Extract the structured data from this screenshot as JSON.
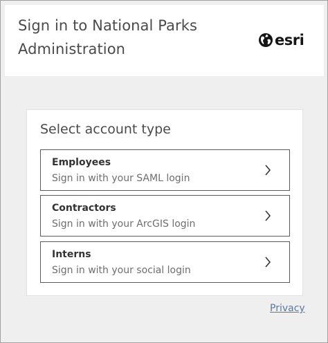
{
  "header": {
    "title": "Sign in to National Parks Administration",
    "logo": {
      "icon": "globe-icon",
      "text": "esri"
    }
  },
  "account": {
    "heading": "Select account type",
    "options": [
      {
        "name": "Employees",
        "description": "Sign in with your SAML login",
        "icon": "chevron-right-icon"
      },
      {
        "name": "Contractors",
        "description": "Sign in with your ArcGIS login",
        "icon": "chevron-right-icon"
      },
      {
        "name": "Interns",
        "description": "Sign in with your social login",
        "icon": "chevron-right-icon"
      }
    ]
  },
  "footer": {
    "privacy_label": "Privacy"
  },
  "colors": {
    "background": "#efefef",
    "text": "#4a4a4a",
    "link": "#5a7a9e",
    "border": "#595959"
  }
}
